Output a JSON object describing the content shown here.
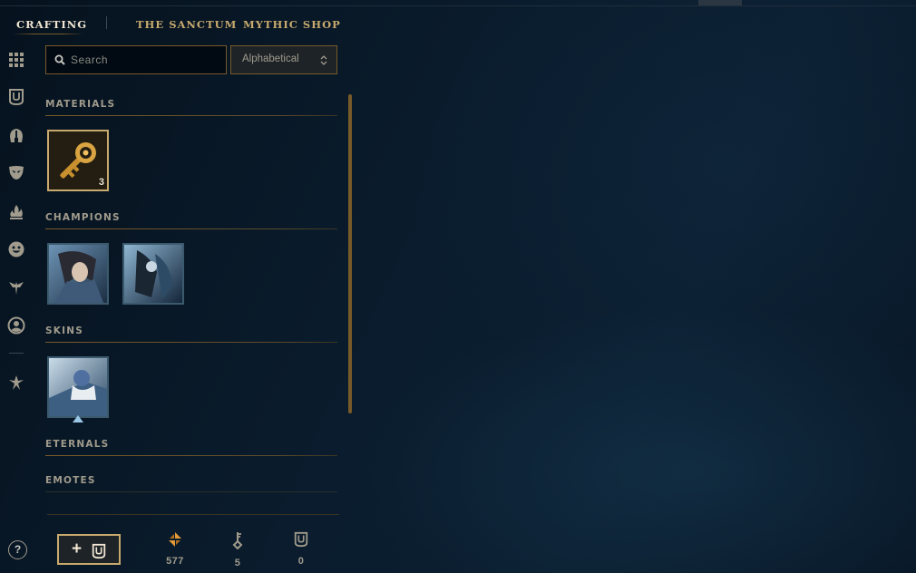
{
  "tabs": [
    {
      "label": "CRAFTING",
      "active": true
    },
    {
      "label": "THE SANCTUM",
      "active": false
    },
    {
      "label": "MYTHIC SHOP",
      "active": false
    }
  ],
  "rail_icons": [
    "grid-icon",
    "chest-icon",
    "helmet-icon",
    "mask-icon",
    "ward-flame-icon",
    "emote-face-icon",
    "crest-icon",
    "profile-icon",
    "eternals-icon"
  ],
  "search": {
    "placeholder": "Search",
    "value": ""
  },
  "sort": {
    "selected": "Alphabetical"
  },
  "sections": {
    "materials": {
      "title": "MATERIALS",
      "items": [
        {
          "name": "key-fragment",
          "count": "3"
        }
      ]
    },
    "champions": {
      "title": "CHAMPIONS",
      "items": [
        {
          "name": "champion-shard-1"
        },
        {
          "name": "champion-shard-2"
        }
      ]
    },
    "skins": {
      "title": "SKINS",
      "items": [
        {
          "name": "skin-shard-1"
        }
      ]
    },
    "eternals": {
      "title": "ETERNALS"
    },
    "emotes": {
      "title": "EMOTES"
    }
  },
  "bottom": {
    "help_label": "?",
    "add_chest_label": "+",
    "currencies": [
      {
        "name": "orange-essence",
        "value": "577"
      },
      {
        "name": "keys",
        "value": "5"
      },
      {
        "name": "chests",
        "value": "0"
      }
    ]
  },
  "colors": {
    "gold": "#c8aa6e",
    "dark_gold": "#785a28",
    "text": "#a09b8c",
    "bright_text": "#f0e6d2",
    "orange_essence": "#e09a3a"
  }
}
